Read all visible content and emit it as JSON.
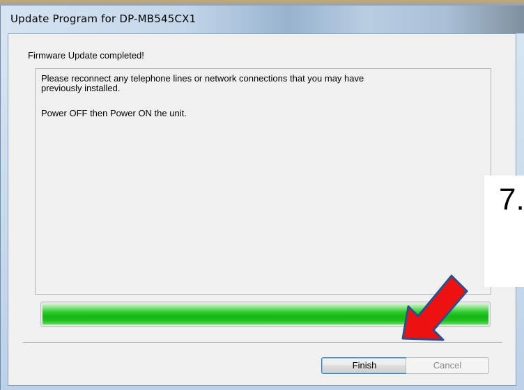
{
  "window": {
    "title": "Update Program for DP-MB545CX1"
  },
  "dialog": {
    "heading": "Firmware Update completed!",
    "message_lines": [
      "Please reconnect any telephone lines or network connections that you may have",
      "previously installed.",
      "Power OFF then Power ON the unit."
    ],
    "progress_percent": 100,
    "progress_color": "#1ebf1e"
  },
  "buttons": {
    "finish_label": "Finish",
    "cancel_label": "Cancel"
  },
  "callout": {
    "step_label": "7.",
    "arrow_color": "#ee1111",
    "arrow_outline": "#2b4f8a"
  }
}
